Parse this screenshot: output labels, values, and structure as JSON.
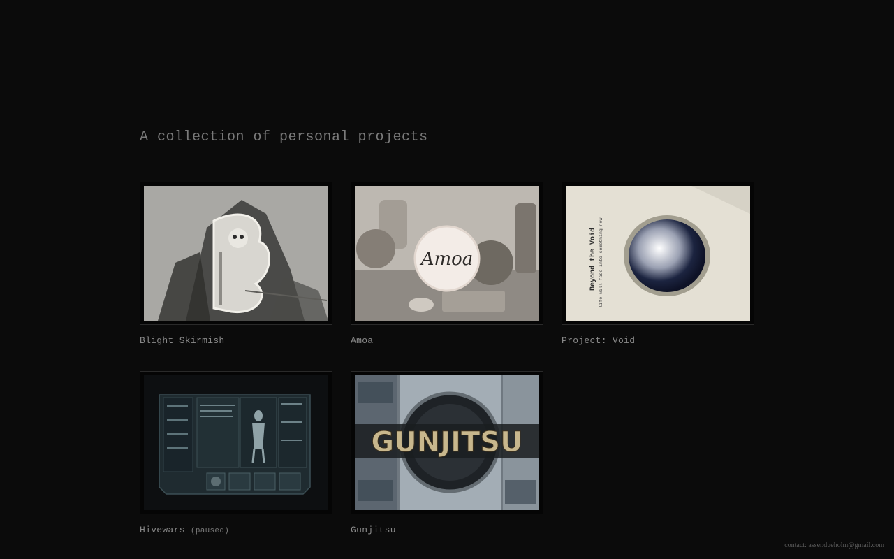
{
  "header": {
    "title": "A collection of personal projects"
  },
  "projects": [
    {
      "title": "Blight Skirmish",
      "note": ""
    },
    {
      "title": "Amoa",
      "note": ""
    },
    {
      "title": "Project: Void",
      "note": ""
    },
    {
      "title": "Hivewars",
      "note": "(paused)"
    },
    {
      "title": "Gunjitsu",
      "note": ""
    }
  ],
  "thumbnails": {
    "amoa_logo_text": "Amoa",
    "void_heading": "Beyond the Void",
    "void_subtitle": "life will fade into something new",
    "gunjitsu_logo_text": "GUNJITSU"
  },
  "footer": {
    "contact": "contact: asser.dueholm@gmail.com"
  },
  "colors": {
    "background": "#0b0b0b",
    "text": "#8a8a8a",
    "frame_border": "#2a2a2a"
  }
}
